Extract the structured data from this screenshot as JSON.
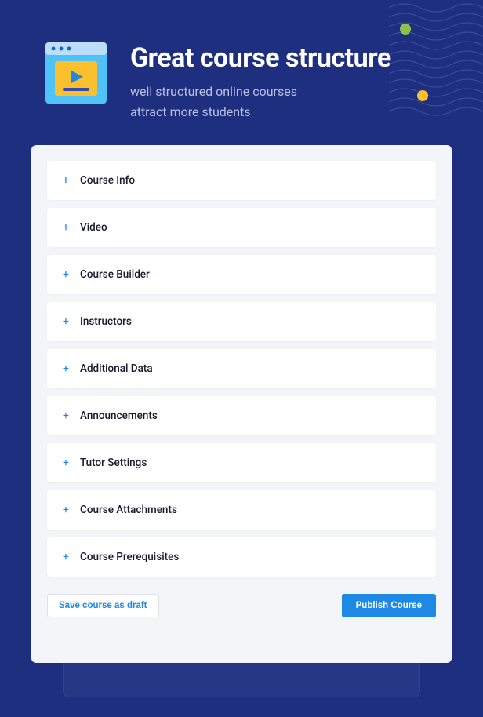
{
  "header": {
    "title": "Great course structure",
    "subtitle_line1": "well structured online courses",
    "subtitle_line2": "attract more students"
  },
  "sections": [
    {
      "label": "Course Info"
    },
    {
      "label": "Video"
    },
    {
      "label": "Course Builder"
    },
    {
      "label": "Instructors"
    },
    {
      "label": "Additional Data"
    },
    {
      "label": "Announcements"
    },
    {
      "label": "Tutor Settings"
    },
    {
      "label": "Course Attachments"
    },
    {
      "label": "Course Prerequisites"
    }
  ],
  "actions": {
    "draft_label": "Save course as draft",
    "publish_label": "Publish Course"
  },
  "colors": {
    "brand_blue": "#1e2f80",
    "accent_blue": "#1e88e5",
    "icon_yellow": "#fbc02d",
    "dot_green": "#8bc34a"
  }
}
